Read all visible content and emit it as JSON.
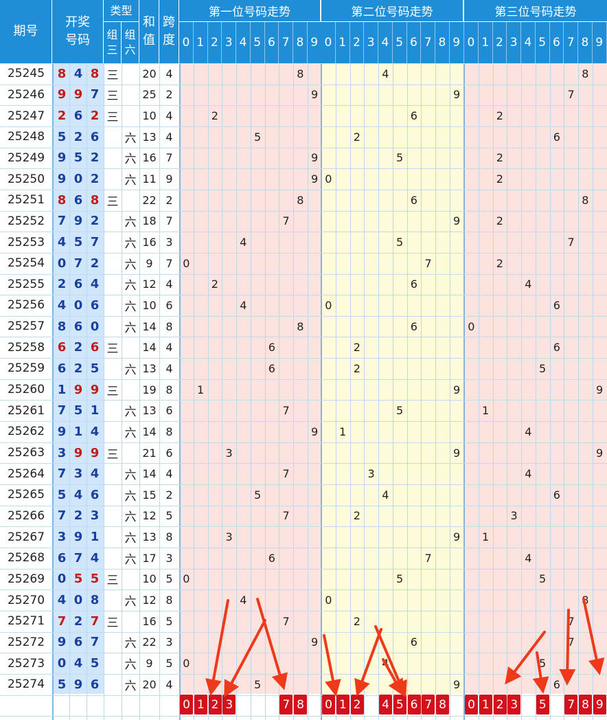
{
  "header": {
    "issue": "期号",
    "draw_line1": "开奖",
    "draw_line2": "号码",
    "type": "类型",
    "zu3_a": "组",
    "zu3_b": "三",
    "zu6_a": "组",
    "zu6_b": "六",
    "sum_a": "和",
    "sum_b": "值",
    "span_a": "跨",
    "span_b": "度",
    "section_titles": [
      "第一位号码走势",
      "第二位号码走势",
      "第三位号码走势"
    ],
    "digit_labels": [
      "0",
      "1",
      "2",
      "3",
      "4",
      "5",
      "6",
      "7",
      "8",
      "9"
    ]
  },
  "rows": [
    {
      "issue": "25245",
      "digits": [
        "8",
        "4",
        "8"
      ],
      "zu3": "三",
      "zu6": "",
      "sum": "20",
      "span": "4"
    },
    {
      "issue": "25246",
      "digits": [
        "9",
        "9",
        "7"
      ],
      "zu3": "三",
      "zu6": "",
      "sum": "25",
      "span": "2"
    },
    {
      "issue": "25247",
      "digits": [
        "2",
        "6",
        "2"
      ],
      "zu3": "三",
      "zu6": "",
      "sum": "10",
      "span": "4"
    },
    {
      "issue": "25248",
      "digits": [
        "5",
        "2",
        "6"
      ],
      "zu3": "",
      "zu6": "六",
      "sum": "13",
      "span": "4"
    },
    {
      "issue": "25249",
      "digits": [
        "9",
        "5",
        "2"
      ],
      "zu3": "",
      "zu6": "六",
      "sum": "16",
      "span": "7"
    },
    {
      "issue": "25250",
      "digits": [
        "9",
        "0",
        "2"
      ],
      "zu3": "",
      "zu6": "六",
      "sum": "11",
      "span": "9"
    },
    {
      "issue": "25251",
      "digits": [
        "8",
        "6",
        "8"
      ],
      "zu3": "三",
      "zu6": "",
      "sum": "22",
      "span": "2"
    },
    {
      "issue": "25252",
      "digits": [
        "7",
        "9",
        "2"
      ],
      "zu3": "",
      "zu6": "六",
      "sum": "18",
      "span": "7"
    },
    {
      "issue": "25253",
      "digits": [
        "4",
        "5",
        "7"
      ],
      "zu3": "",
      "zu6": "六",
      "sum": "16",
      "span": "3"
    },
    {
      "issue": "25254",
      "digits": [
        "0",
        "7",
        "2"
      ],
      "zu3": "",
      "zu6": "六",
      "sum": "9",
      "span": "7"
    },
    {
      "issue": "25255",
      "digits": [
        "2",
        "6",
        "4"
      ],
      "zu3": "",
      "zu6": "六",
      "sum": "12",
      "span": "4"
    },
    {
      "issue": "25256",
      "digits": [
        "4",
        "0",
        "6"
      ],
      "zu3": "",
      "zu6": "六",
      "sum": "10",
      "span": "6"
    },
    {
      "issue": "25257",
      "digits": [
        "8",
        "6",
        "0"
      ],
      "zu3": "",
      "zu6": "六",
      "sum": "14",
      "span": "8"
    },
    {
      "issue": "25258",
      "digits": [
        "6",
        "2",
        "6"
      ],
      "zu3": "三",
      "zu6": "",
      "sum": "14",
      "span": "4"
    },
    {
      "issue": "25259",
      "digits": [
        "6",
        "2",
        "5"
      ],
      "zu3": "",
      "zu6": "六",
      "sum": "13",
      "span": "4"
    },
    {
      "issue": "25260",
      "digits": [
        "1",
        "9",
        "9"
      ],
      "zu3": "三",
      "zu6": "",
      "sum": "19",
      "span": "8"
    },
    {
      "issue": "25261",
      "digits": [
        "7",
        "5",
        "1"
      ],
      "zu3": "",
      "zu6": "六",
      "sum": "13",
      "span": "6"
    },
    {
      "issue": "25262",
      "digits": [
        "9",
        "1",
        "4"
      ],
      "zu3": "",
      "zu6": "六",
      "sum": "14",
      "span": "8"
    },
    {
      "issue": "25263",
      "digits": [
        "3",
        "9",
        "9"
      ],
      "zu3": "三",
      "zu6": "",
      "sum": "21",
      "span": "6"
    },
    {
      "issue": "25264",
      "digits": [
        "7",
        "3",
        "4"
      ],
      "zu3": "",
      "zu6": "六",
      "sum": "14",
      "span": "4"
    },
    {
      "issue": "25265",
      "digits": [
        "5",
        "4",
        "6"
      ],
      "zu3": "",
      "zu6": "六",
      "sum": "15",
      "span": "2"
    },
    {
      "issue": "25266",
      "digits": [
        "7",
        "2",
        "3"
      ],
      "zu3": "",
      "zu6": "六",
      "sum": "12",
      "span": "5"
    },
    {
      "issue": "25267",
      "digits": [
        "3",
        "9",
        "1"
      ],
      "zu3": "",
      "zu6": "六",
      "sum": "13",
      "span": "8"
    },
    {
      "issue": "25268",
      "digits": [
        "6",
        "7",
        "4"
      ],
      "zu3": "",
      "zu6": "六",
      "sum": "17",
      "span": "3"
    },
    {
      "issue": "25269",
      "digits": [
        "0",
        "5",
        "5"
      ],
      "zu3": "三",
      "zu6": "",
      "sum": "10",
      "span": "5"
    },
    {
      "issue": "25270",
      "digits": [
        "4",
        "0",
        "8"
      ],
      "zu3": "",
      "zu6": "六",
      "sum": "12",
      "span": "8"
    },
    {
      "issue": "25271",
      "digits": [
        "7",
        "2",
        "7"
      ],
      "zu3": "三",
      "zu6": "",
      "sum": "16",
      "span": "5"
    },
    {
      "issue": "25272",
      "digits": [
        "9",
        "6",
        "7"
      ],
      "zu3": "",
      "zu6": "六",
      "sum": "22",
      "span": "3"
    },
    {
      "issue": "25273",
      "digits": [
        "0",
        "4",
        "5"
      ],
      "zu3": "",
      "zu6": "六",
      "sum": "9",
      "span": "5"
    },
    {
      "issue": "25274",
      "digits": [
        "5",
        "9",
        "6"
      ],
      "zu3": "",
      "zu6": "六",
      "sum": "20",
      "span": "4"
    }
  ],
  "picks": [
    [
      "0",
      "1",
      "2",
      "3",
      "7",
      "8"
    ],
    [
      "0",
      "1",
      "2",
      "4",
      "5",
      "6",
      "7",
      "8"
    ],
    [
      "0",
      "1",
      "2",
      "3",
      "5",
      "7",
      "8",
      "9"
    ]
  ],
  "colors": {
    "header_blue": "#1f8ed6",
    "digit_blue": "#1c3f9e",
    "digit_red": "#c41a1a",
    "section_pink": "#fde3df",
    "section_yellow": "#fdfbd9",
    "draw_column_bg": "#cfe6fb",
    "pick_badge": "#d4101a",
    "arrow": "#ee3a1a"
  },
  "chart_data": {
    "type": "table",
    "title": "",
    "sections": [
      "第一位号码走势",
      "第二位号码走势",
      "第三位号码走势"
    ],
    "x": [
      "25245",
      "25246",
      "25247",
      "25248",
      "25249",
      "25250",
      "25251",
      "25252",
      "25253",
      "25254",
      "25255",
      "25256",
      "25257",
      "25258",
      "25259",
      "25260",
      "25261",
      "25262",
      "25263",
      "25264",
      "25265",
      "25266",
      "25267",
      "25268",
      "25269",
      "25270",
      "25271",
      "25272",
      "25273",
      "25274"
    ],
    "series": [
      {
        "name": "第一位号码走势",
        "values": [
          8,
          9,
          2,
          5,
          9,
          9,
          8,
          7,
          4,
          0,
          2,
          4,
          8,
          6,
          6,
          1,
          7,
          9,
          3,
          7,
          5,
          7,
          3,
          6,
          0,
          4,
          7,
          9,
          0,
          5
        ]
      },
      {
        "name": "第二位号码走势",
        "values": [
          4,
          9,
          6,
          2,
          5,
          0,
          6,
          9,
          5,
          7,
          6,
          0,
          6,
          2,
          2,
          9,
          5,
          1,
          9,
          3,
          4,
          2,
          9,
          7,
          5,
          0,
          2,
          6,
          4,
          9
        ]
      },
      {
        "name": "第三位号码走势",
        "values": [
          8,
          7,
          2,
          6,
          2,
          2,
          8,
          2,
          7,
          2,
          4,
          6,
          0,
          6,
          5,
          9,
          1,
          4,
          9,
          4,
          6,
          3,
          1,
          4,
          5,
          8,
          7,
          7,
          5,
          6
        ]
      }
    ],
    "sum": [
      20,
      25,
      10,
      13,
      16,
      11,
      22,
      18,
      16,
      9,
      12,
      10,
      14,
      14,
      13,
      19,
      13,
      14,
      21,
      14,
      15,
      12,
      13,
      17,
      10,
      12,
      16,
      22,
      9,
      20
    ],
    "span": [
      4,
      2,
      4,
      4,
      7,
      9,
      2,
      7,
      3,
      7,
      4,
      6,
      8,
      4,
      4,
      8,
      6,
      8,
      6,
      4,
      2,
      5,
      8,
      3,
      5,
      8,
      5,
      3,
      5,
      4
    ],
    "ylim": [
      0,
      9
    ]
  }
}
